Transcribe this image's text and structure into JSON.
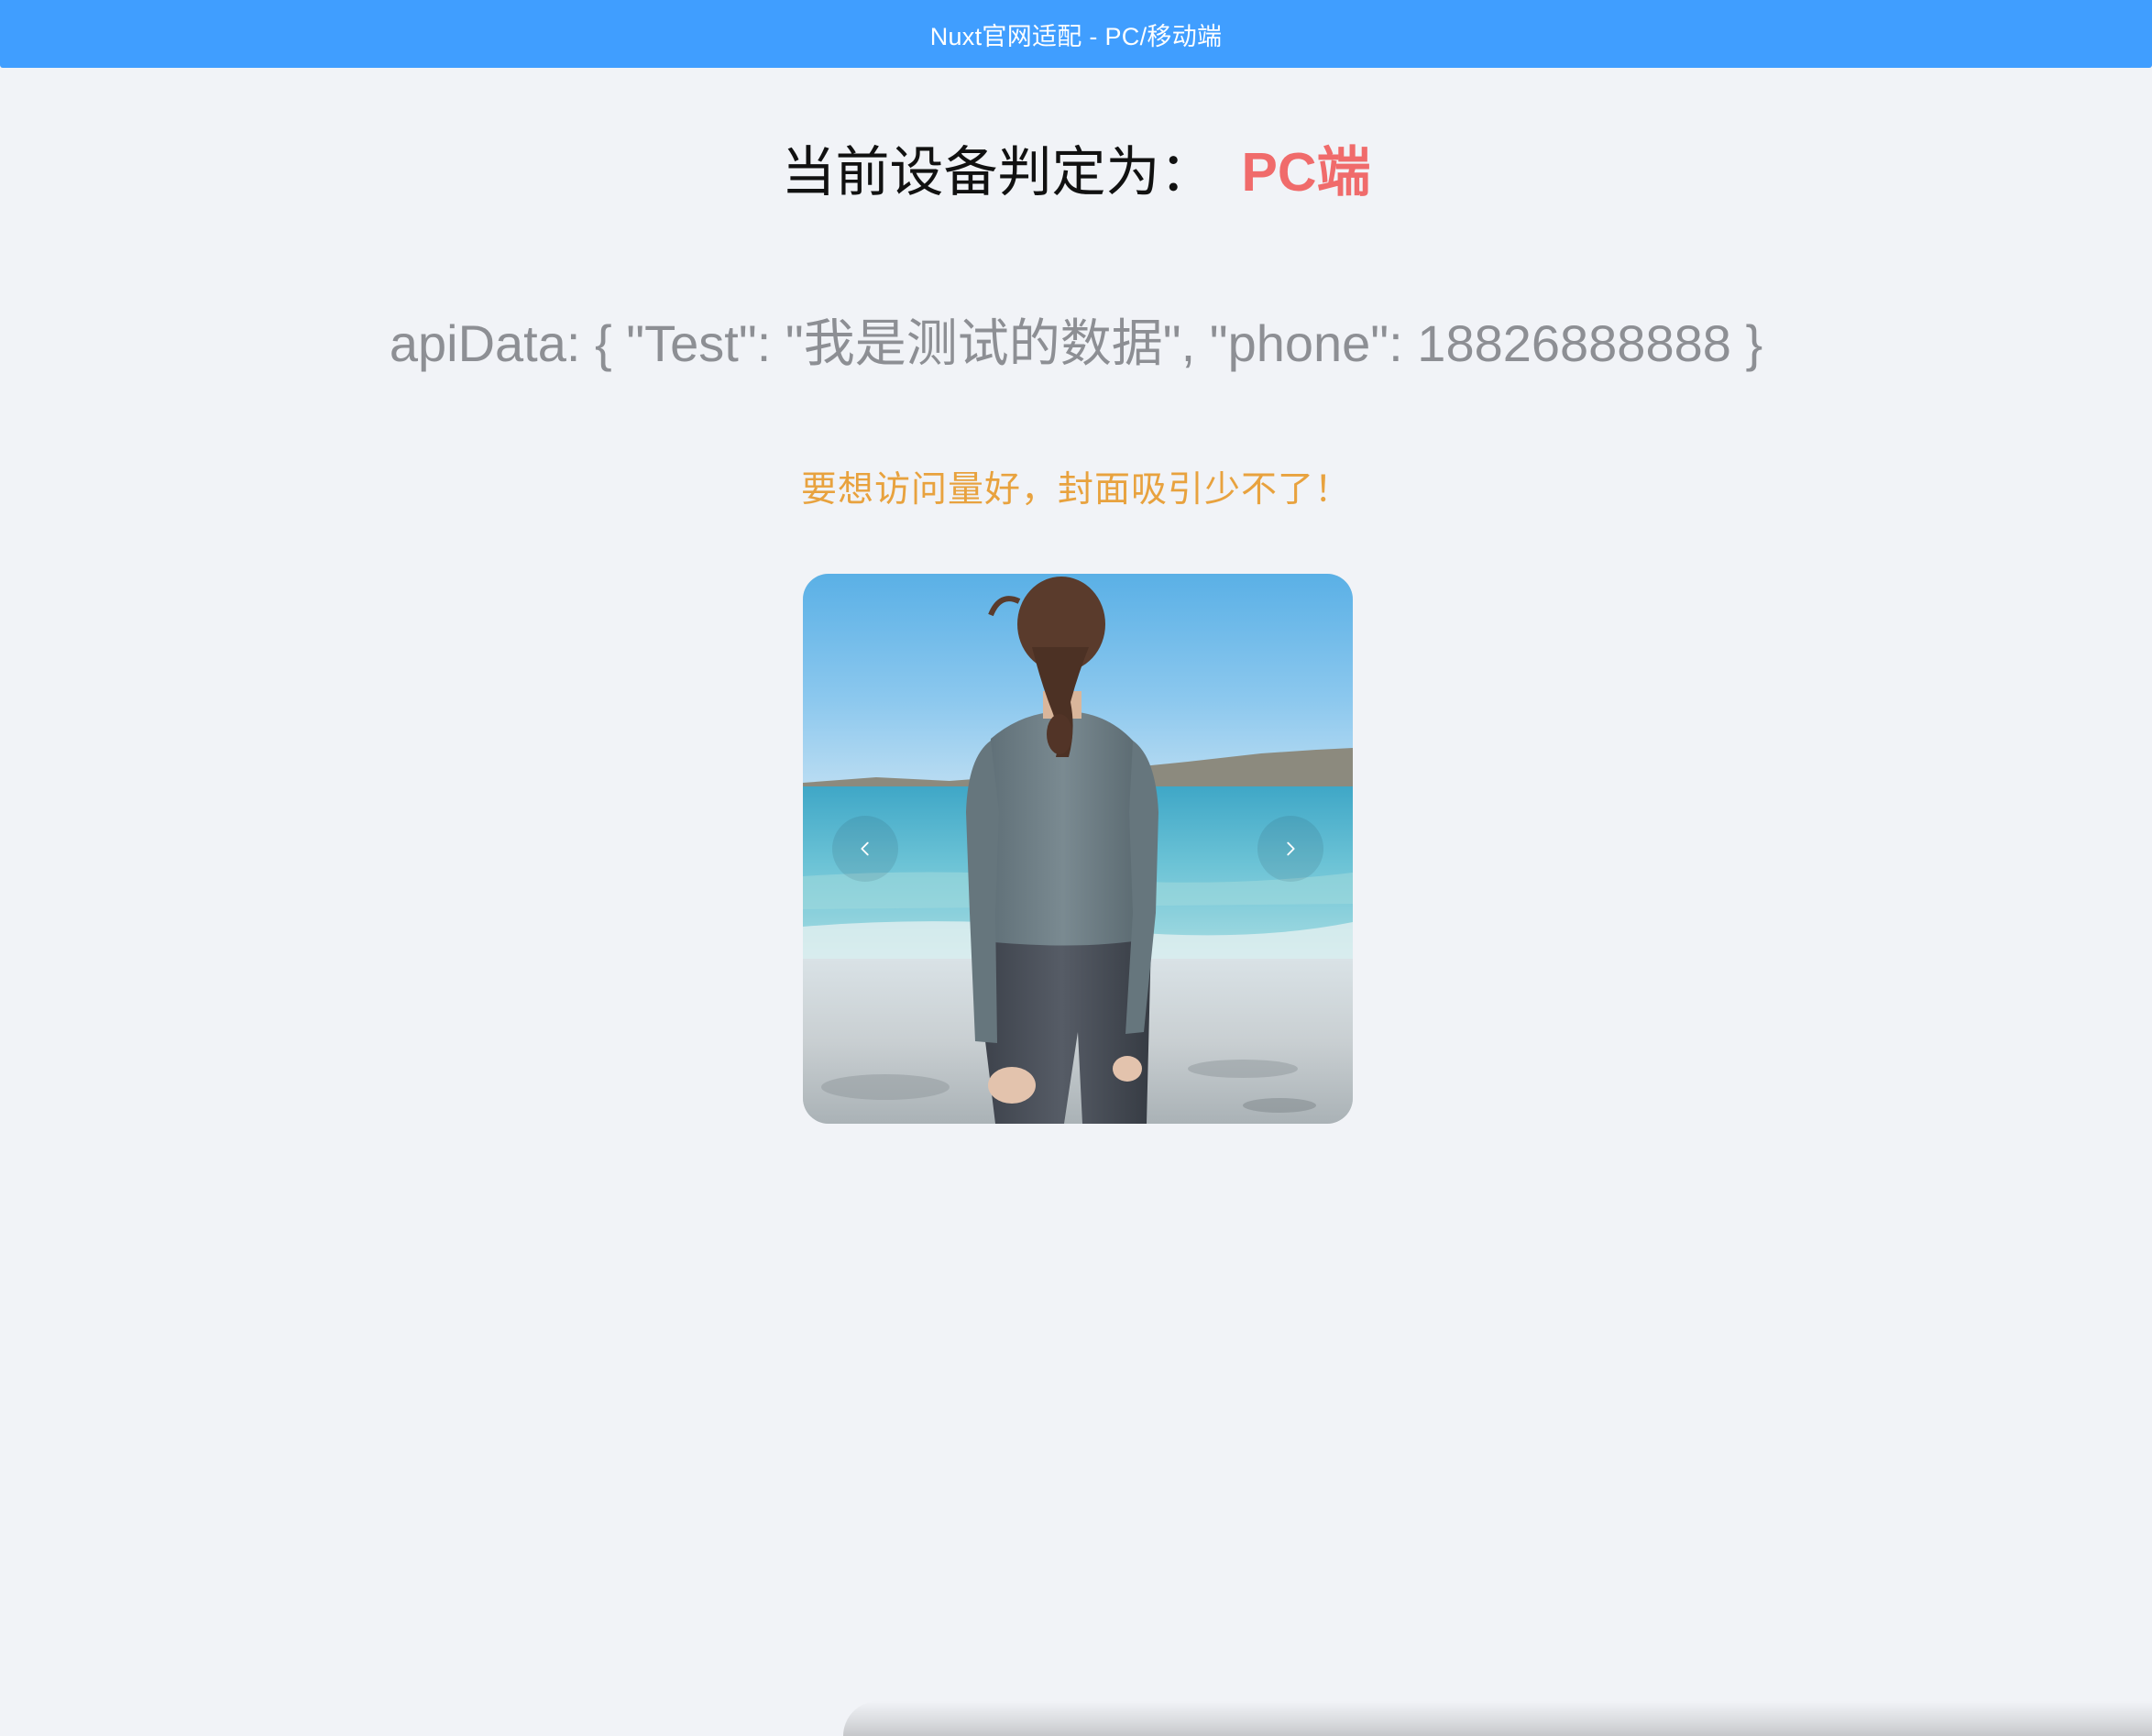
{
  "header": {
    "title": "Nuxt官网适配 - PC/移动端"
  },
  "device": {
    "label": "当前设备判定为：",
    "value": "PC端"
  },
  "api": {
    "text": "apiData: { \"Test\": \"我是测试的数据\", \"phone\": 18826888888 }"
  },
  "slogan": {
    "text": "要想访问量好，封面吸引少不了！"
  },
  "carousel": {
    "prev_icon": "chevron-left-icon",
    "next_icon": "chevron-right-icon",
    "image": "photo-woman-on-beach"
  },
  "colors": {
    "header_bg": "#409eff",
    "device_value": "#f06b6b",
    "api_text": "#8d8f94",
    "slogan": "#e8a23e",
    "page_bg": "#f1f3f7"
  }
}
